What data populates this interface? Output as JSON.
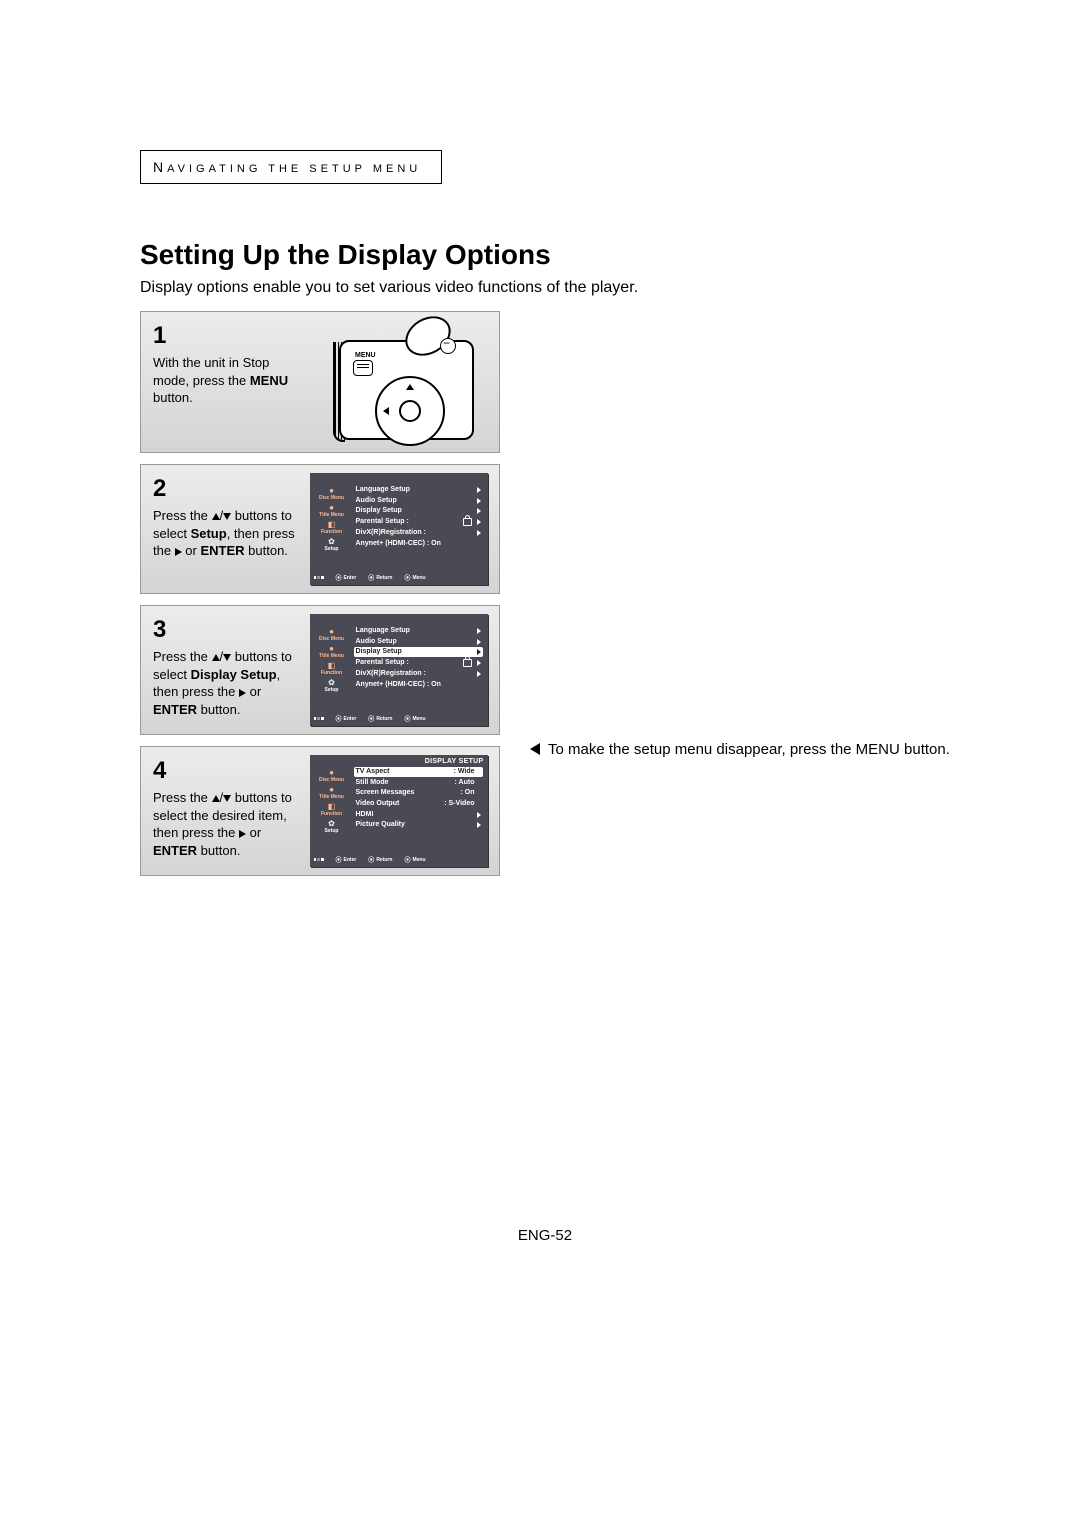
{
  "breadcrumb_main": "N",
  "breadcrumb_rest": "AVIGATING THE SETUP MENU",
  "title": "Setting Up the Display Options",
  "intro": "Display options enable you to set various video functions of the player.",
  "steps": {
    "s1": {
      "num": "1",
      "text_before": "With the unit in Stop mode, press the ",
      "bold1": "MENU",
      "text_after": " button.",
      "remote_label": "MENU"
    },
    "s2": {
      "num": "2",
      "t1": "Press the ",
      "t2": " buttons to select ",
      "bold1": "Setup",
      "t3": ", then press the ",
      "t4": " or ",
      "bold2": "ENTER",
      "t5": " button."
    },
    "s3": {
      "num": "3",
      "t1": "Press the ",
      "t2": " buttons to select ",
      "bold1": "Display Setup",
      "t3": ", then press the ",
      "t4": " or ",
      "bold2": "ENTER",
      "t5": " button."
    },
    "s4": {
      "num": "4",
      "t1": "Press the ",
      "t2": " buttons to select the desired item, then press the ",
      "t3": " or ",
      "bold2": "ENTER",
      "t4": " button."
    }
  },
  "osd_setup": {
    "side": [
      {
        "icon": "●",
        "label": "Disc Menu"
      },
      {
        "icon": "●",
        "label": "Title Menu"
      },
      {
        "icon": "◧",
        "label": "Function"
      },
      {
        "icon": "✿",
        "label": "Setup"
      }
    ],
    "rows": [
      {
        "name": "Language Setup",
        "arrow": true
      },
      {
        "name": "Audio Setup",
        "arrow": true
      },
      {
        "name": "Display Setup",
        "arrow": true
      },
      {
        "name": "Parental Setup :",
        "lock": true,
        "arrow": true
      },
      {
        "name": "DivX(R)Registration :",
        "arrow": true
      },
      {
        "name": "Anynet+ (HDMI-CEC) : On"
      }
    ],
    "foot": [
      "Enter",
      "Return",
      "Menu"
    ]
  },
  "osd_display": {
    "title": "DISPLAY SETUP",
    "side": [
      {
        "icon": "●",
        "label": "Disc Menu"
      },
      {
        "icon": "●",
        "label": "Title Menu"
      },
      {
        "icon": "◧",
        "label": "Function"
      },
      {
        "icon": "✿",
        "label": "Setup"
      }
    ],
    "rows": [
      {
        "name": "TV Aspect",
        "val": ": Wide"
      },
      {
        "name": "Still Mode",
        "val": ": Auto"
      },
      {
        "name": "Screen Messages",
        "val": ": On"
      },
      {
        "name": "Video Output",
        "val": ": S-Video"
      },
      {
        "name": "HDMI",
        "arrow": true
      },
      {
        "name": "Picture Quality",
        "arrow": true
      }
    ],
    "foot": [
      "Enter",
      "Return",
      "Menu"
    ]
  },
  "note": "To make the setup menu disappear, press the MENU button.",
  "page_num": "ENG-52"
}
